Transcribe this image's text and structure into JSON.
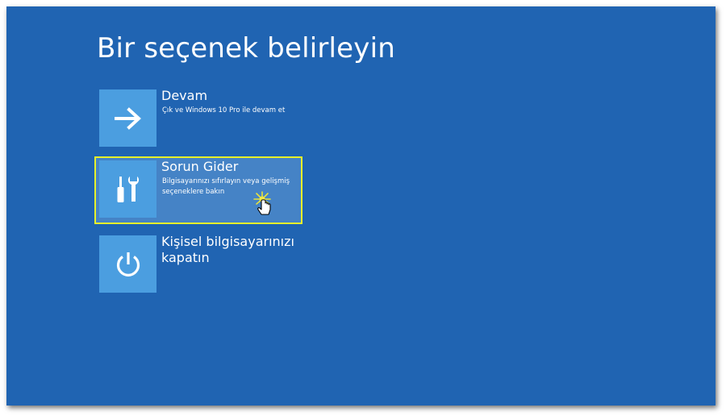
{
  "page": {
    "title": "Bir seçenek belirleyin"
  },
  "options": [
    {
      "icon": "arrow-right-icon",
      "title": "Devam",
      "description": "Çık ve Windows 10 Pro ile devam et",
      "selected": false
    },
    {
      "icon": "tools-icon",
      "title": "Sorun Gider",
      "description": "Bilgisayarınızı sıfırlayın veya gelişmiş seçeneklere bakın",
      "selected": true
    },
    {
      "icon": "power-icon",
      "title": "Kişisel bilgisayarınızı kapatın",
      "description": "",
      "selected": false
    }
  ],
  "colors": {
    "background": "#2064b2",
    "tile": "#4b9ee0",
    "selected_fill": "#4583c6",
    "selected_border": "#e6f02a"
  }
}
